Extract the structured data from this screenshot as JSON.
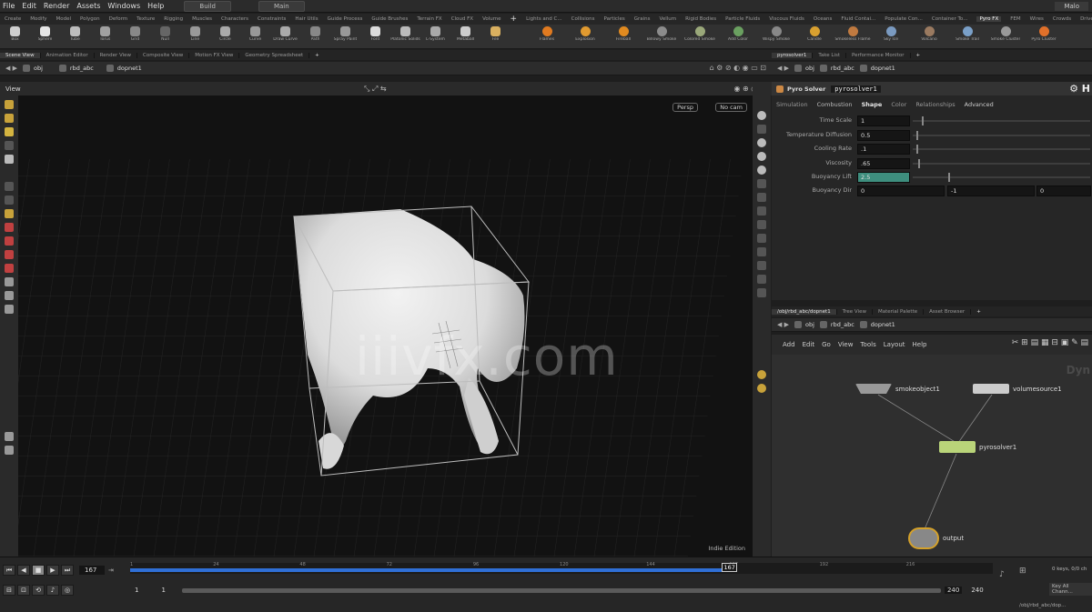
{
  "menubar": {
    "items": [
      "File",
      "Edit",
      "Render",
      "Assets",
      "Windows",
      "Help"
    ],
    "desktop": "Build",
    "desktop2": "Main",
    "user": "Malo"
  },
  "shelf_tabs_left": [
    "Create",
    "Modify",
    "Model",
    "Polygon",
    "Deform",
    "Texture",
    "Rigging",
    "Muscles",
    "Characters",
    "Constraints",
    "Hair Utils",
    "Guide Process",
    "Guide Brushes",
    "Terrain FX",
    "Cloud FX",
    "Volume"
  ],
  "shelf_tabs_right": [
    "Lights and C...",
    "Collisions",
    "Particles",
    "Grains",
    "Vellum",
    "Rigid Bodies",
    "Particle Fluids",
    "Viscous Fluids",
    "Oceans",
    "Fluid Contai...",
    "Populate Con...",
    "Container To...",
    "Pyro FX",
    "FEM",
    "Wires",
    "Crowds",
    "Drive Si..."
  ],
  "shelf_tools_left": [
    "Box",
    "Sphere",
    "Tube",
    "Torus",
    "Grid",
    "Null",
    "Line",
    "Circle",
    "Curve",
    "Draw Curve",
    "Path",
    "Spray Paint",
    "Font",
    "Platonic Solids",
    "L-System",
    "Metaball",
    "File"
  ],
  "shelf_tools_right": [
    "Flames",
    "Explosion",
    "Fireball",
    "Billowy Smoke",
    "Colored Smoke",
    "Add Color",
    "Wispy Smoke",
    "Candle",
    "Smokeless Flame",
    "Sky Ice",
    "Volcano",
    "Smoke Trail",
    "Smoke Cluster",
    "Pyro Cluster"
  ],
  "viewer": {
    "tabs": [
      "Scene View",
      "Animation Editor",
      "Render View",
      "Composite View",
      "Motion FX View",
      "Geometry Spreadsheet"
    ],
    "path": [
      "obj",
      "rbd_abc",
      "dopnet1"
    ],
    "view_label": "View",
    "persp": "Persp",
    "cam": "No cam",
    "edition": "Indie Edition",
    "watermark": "iiivfx.com"
  },
  "param_pane": {
    "tabs": [
      "pyrosolver1",
      "Take List",
      "Performance Monitor"
    ],
    "path": [
      "obj",
      "rbd_abc",
      "dopnet1"
    ],
    "node_type": "Pyro Solver",
    "node_name": "pyrosolver1",
    "param_tabs": [
      "Simulation",
      "Combustion",
      "Shape",
      "Color",
      "Relationships",
      "Advanced"
    ],
    "active_tab": "Shape",
    "params": [
      {
        "label": "Time Scale",
        "value": "1",
        "slider": 0.05
      },
      {
        "label": "Temperature Diffusion",
        "value": "0.5",
        "slider": 0.02
      },
      {
        "label": "Cooling Rate",
        "value": ".1",
        "slider": 0.02
      },
      {
        "label": "Viscosity",
        "value": ".65",
        "slider": 0.03
      },
      {
        "label": "Buoyancy Lift",
        "value": "2.5",
        "slider": 0.2
      }
    ],
    "buoyancy_dir": {
      "label": "Buoyancy Dir",
      "x": "0",
      "y": "-1",
      "z": "0"
    }
  },
  "network": {
    "tabs": [
      "/obj/rbd_abc/dopnet1",
      "Tree View",
      "Material Palette",
      "Asset Browser"
    ],
    "path": [
      "obj",
      "rbd_abc",
      "dopnet1"
    ],
    "menu": [
      "Add",
      "Edit",
      "Go",
      "View",
      "Tools",
      "Layout",
      "Help"
    ],
    "context": "Dyn",
    "nodes": {
      "smoke": "smokeobject1",
      "volume": "volumesource1",
      "solver": "pyrosolver1",
      "output": "output"
    }
  },
  "timeline": {
    "frame": "167",
    "ticks": [
      "1",
      "24",
      "48",
      "72",
      "96",
      "120",
      "144",
      "167",
      "192",
      "216"
    ],
    "current_marker": "167",
    "start": "1",
    "start2": "1",
    "end": "240",
    "end2": "240",
    "keys_label": "0 keys, 0/0 ch",
    "key_all": "Key All Chann...",
    "status_path": "/obj/rbd_abc/dop..."
  }
}
